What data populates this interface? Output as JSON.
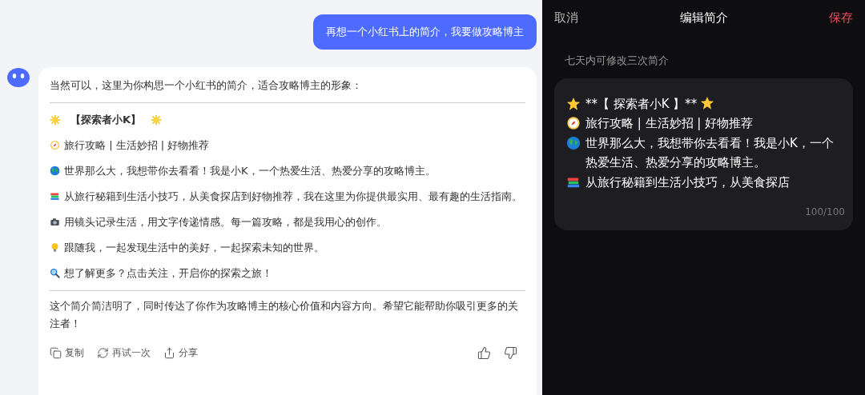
{
  "chat": {
    "user_message": "再想一个小红书上的简介，我要做攻略博主",
    "reply": {
      "intro": "当然可以，这里为你构思一个小红书的简介，适合攻略博主的形象：",
      "title": "【探索者小K】",
      "lines": [
        {
          "kind": "compass",
          "text": "旅行攻略 | 生活妙招 | 好物推荐"
        },
        {
          "kind": "globe",
          "text": "世界那么大，我想带你去看看！我是小K，一个热爱生活、热爱分享的攻略博主。"
        },
        {
          "kind": "books",
          "text": "从旅行秘籍到生活小技巧，从美食探店到好物推荐，我在这里为你提供最实用、最有趣的生活指南。"
        },
        {
          "kind": "camera",
          "text": "用镜头记录生活，用文字传递情感。每一篇攻略，都是我用心的创作。"
        },
        {
          "kind": "bulb",
          "text": "跟随我，一起发现生活中的美好，一起探索未知的世界。"
        },
        {
          "kind": "search",
          "text": "想了解更多？点击关注，开启你的探索之旅！"
        }
      ],
      "closing": "这个简介简洁明了，同时传达了你作为攻略博主的核心价值和内容方向。希望它能帮助你吸引更多的关注者！",
      "actions": [
        {
          "kind": "copy",
          "label": "复制"
        },
        {
          "kind": "retry",
          "label": "再试一次"
        },
        {
          "kind": "share",
          "label": "分享"
        }
      ]
    }
  },
  "editor": {
    "cancel": "取消",
    "title": "编辑简介",
    "save": "保存",
    "hint": "七天内可修改三次简介",
    "lines": [
      {
        "kind": "title",
        "text": "**【 探索者小K 】**"
      },
      {
        "kind": "compass",
        "text": "旅行攻略 | 生活妙招 | 好物推荐"
      },
      {
        "kind": "globe",
        "text": "世界那么大，我想带你去看看！我是小K，一个热爱生活、热爱分享的攻略博主。"
      },
      {
        "kind": "books",
        "text": "从旅行秘籍到生活小技巧，从美食探店"
      }
    ],
    "counter": "100/100"
  }
}
